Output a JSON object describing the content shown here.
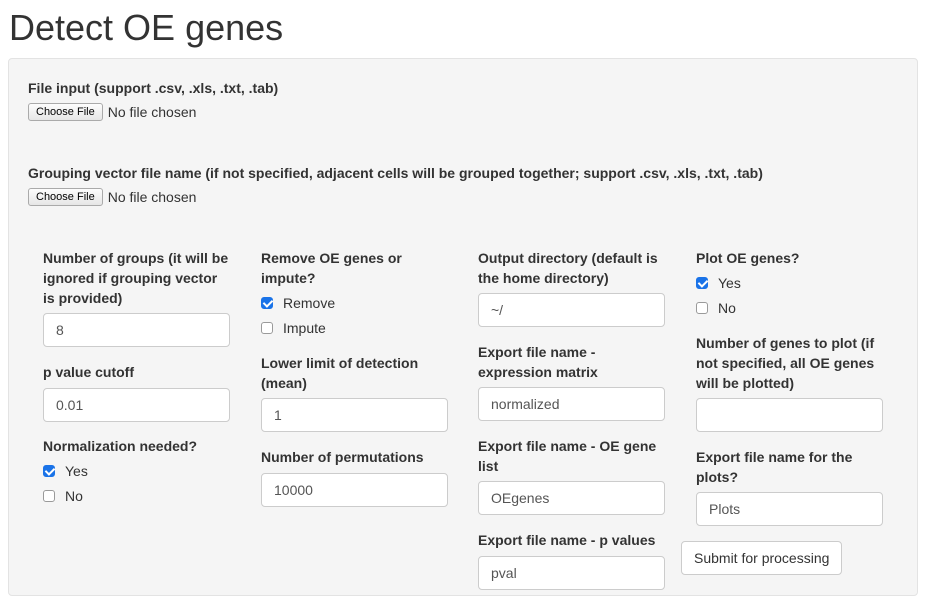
{
  "page": {
    "title": "Detect OE genes"
  },
  "file_input": {
    "label": "File input (support .csv, .xls, .txt, .tab)",
    "button": "Choose File",
    "status": "No file chosen"
  },
  "grouping_input": {
    "label": "Grouping vector file name (if not specified, adjacent cells will be grouped together; support .csv, .xls, .txt, .tab)",
    "button": "Choose File",
    "status": "No file chosen"
  },
  "col1": {
    "num_groups": {
      "label_lines": [
        "Number of groups (it will be",
        "ignored if grouping vector",
        "is provided)"
      ],
      "value": "8"
    },
    "pvalue": {
      "label": "p value cutoff",
      "value": "0.01"
    },
    "normalization": {
      "label": "Normalization needed?",
      "yes": "Yes",
      "no": "No",
      "selected": "Yes"
    }
  },
  "col2": {
    "remove_oe": {
      "label_lines": [
        "Remove OE genes or",
        "impute?"
      ],
      "remove": "Remove",
      "impute": "Impute",
      "selected": "Remove"
    },
    "lower_limit": {
      "label_lines": [
        "Lower limit of detection",
        "(mean)"
      ],
      "value": "1"
    },
    "permutations": {
      "label": "Number of permutations",
      "value": "10000"
    }
  },
  "col3": {
    "output_dir": {
      "label_lines": [
        "Output directory (default is",
        "the home directory)"
      ],
      "value": "~/"
    },
    "export_expr": {
      "label_lines": [
        "Export file name -",
        "expression matrix"
      ],
      "value": "normalized"
    },
    "export_oe": {
      "label_lines": [
        "Export file name - OE gene",
        "list"
      ],
      "value": "OEgenes"
    },
    "export_pval": {
      "label": "Export file name - p values",
      "value": "pval"
    }
  },
  "col4": {
    "plot_oe": {
      "label": "Plot OE genes?",
      "yes": "Yes",
      "no": "No",
      "selected": "Yes"
    },
    "num_plot": {
      "label_lines": [
        "Number of genes to plot (if",
        "not specified, all OE genes",
        "will be plotted)"
      ],
      "value": ""
    },
    "export_plots": {
      "label_lines": [
        "Export file name for the",
        "plots?"
      ],
      "value": "Plots"
    }
  },
  "submit": {
    "label": "Submit for processing"
  }
}
